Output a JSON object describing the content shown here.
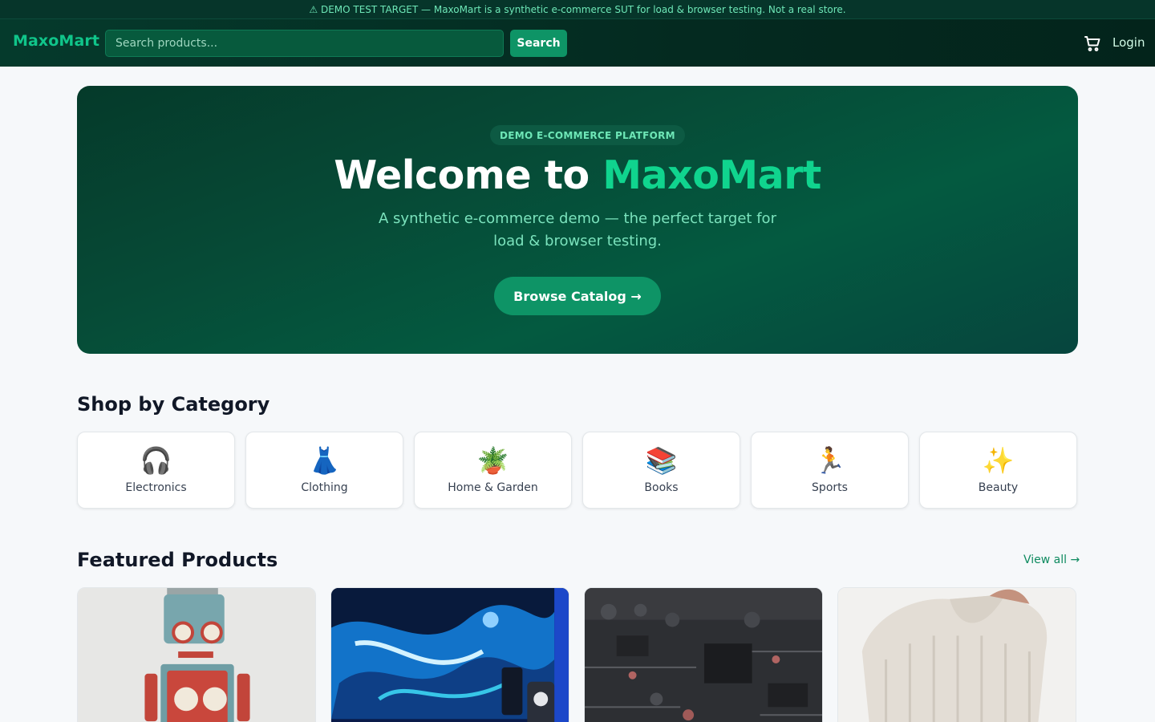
{
  "banner": {
    "text": "⚠ DEMO TEST TARGET — MaxoMart is a synthetic e-commerce SUT for load & browser testing. Not a real store."
  },
  "nav": {
    "logo": "MaxoMart",
    "search_placeholder": "Search products...",
    "search_button": "Search",
    "cart_icon": "cart-icon",
    "login": "Login"
  },
  "hero": {
    "badge": "DEMO E-COMMERCE PLATFORM",
    "title_prefix": "Welcome to ",
    "title_accent": "MaxoMart",
    "subtitle": "A synthetic e-commerce demo — the perfect target for load & browser testing.",
    "cta": "Browse Catalog →"
  },
  "categories": {
    "title": "Shop by Category",
    "items": [
      {
        "label": "Electronics",
        "emoji": "🎧"
      },
      {
        "label": "Clothing",
        "emoji": "👗"
      },
      {
        "label": "Home & Garden",
        "emoji": "🪴"
      },
      {
        "label": "Books",
        "emoji": "📚"
      },
      {
        "label": "Sports",
        "emoji": "🏃"
      },
      {
        "label": "Beauty",
        "emoji": "✨"
      }
    ]
  },
  "featured": {
    "title": "Featured Products",
    "view_all": "View all →",
    "products": [
      {
        "image": "robot-toy-photo"
      },
      {
        "image": "monitor-setup-photo"
      },
      {
        "image": "circuit-board-photo"
      },
      {
        "image": "knit-sweater-photo"
      }
    ]
  },
  "colors": {
    "brand": "#10c58a",
    "primary_button": "#0e9466",
    "nav_bg": "#042a20",
    "hero_bg": "#064a36"
  }
}
